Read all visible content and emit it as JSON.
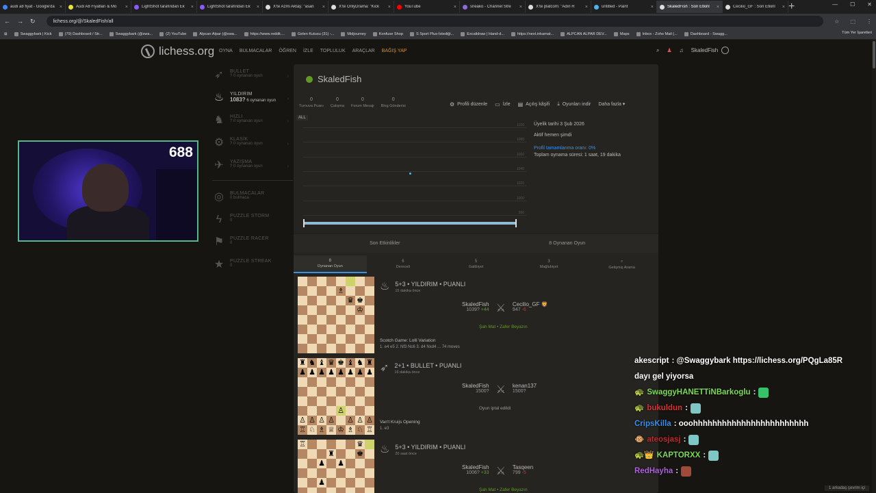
{
  "browser": {
    "tabs": [
      {
        "title": "audi a8 fiyat - Google'da",
        "color": "#4285f4"
      },
      {
        "title": "Audi A8 Fiyatları & Mo",
        "color": "#e8e33a"
      },
      {
        "title": "LightShot tarafından Ek",
        "color": "#8a5cf6"
      },
      {
        "title": "LightShot tarafından Ek",
        "color": "#8a5cf6"
      },
      {
        "title": "X'te Azmi Aktaş: \"asan",
        "color": "#dddddd"
      },
      {
        "title": "X'te OnlyDrama: \"Kick",
        "color": "#dddddd"
      },
      {
        "title": "YouTube",
        "color": "#ff0000"
      },
      {
        "title": "sneako - Channel Stre",
        "color": "#8b6bd9"
      },
      {
        "title": "X'te platcom: \"Adın R",
        "color": "#dddddd"
      },
      {
        "title": "untitled - Paint",
        "color": "#4fb3e8"
      },
      {
        "title": "SkaledFish : Son Etkinl",
        "color": "#dddddd"
      },
      {
        "title": "Cecilio_GF : Son Etkinl",
        "color": "#dddddd"
      }
    ],
    "url": "lichess.org/@/SkaledFish/all",
    "bookmarks": [
      "Swaggybark | Kick",
      "(79) Dashboard / Str...",
      "Swaggybark (@swa...",
      "(2) YouTube",
      "Alpcan Alpar (@swa...",
      "https://www.reddit....",
      "Gelen Kutusu (31) -...",
      "Midjourney",
      "Konfuse Shop",
      "S Sport Plus-İstediği...",
      "Excalidraw | Hand-d...",
      "https://next.inkamat...",
      "ALPCAN ALPAR DEV...",
      "Maps",
      "Inbox - Zoho Mail (...",
      "Dashboard - Swagg..."
    ],
    "all_bookmarks": "Tüm Yer İşaretleri"
  },
  "header": {
    "logo": "lichess.org",
    "nav": [
      "OYNA",
      "BULMACALAR",
      "ÖĞREN",
      "İZLE",
      "TOPLULUK",
      "ARAÇLAR"
    ],
    "donate": "BAĞIŞ YAP",
    "user": "SkaledFish"
  },
  "sidebar": {
    "perfs": [
      {
        "name": "BULLET",
        "val": "? 0 oynanan oyun",
        "icon": "➶",
        "active": false
      },
      {
        "name": "YILDIRIM",
        "rating": "1083?",
        "val": "6 oynanan oyun",
        "icon": "♨",
        "active": true
      },
      {
        "name": "HIZLI",
        "val": "? 0 oynanan oyun",
        "icon": "♞",
        "active": false
      },
      {
        "name": "KLASİK",
        "val": "? 0 oynanan oyun",
        "icon": "⚙",
        "active": false
      },
      {
        "name": "YAZIŞMA",
        "val": "? 0 oynanan oyun",
        "icon": "✈",
        "active": false
      }
    ],
    "puzzles": [
      {
        "name": "BULMACALAR",
        "val": "0 bulmaca",
        "icon": "◎"
      },
      {
        "name": "PUZZLE STORM",
        "val": "0",
        "icon": "ϟ"
      },
      {
        "name": "PUZZLE RACER",
        "val": "0",
        "icon": "⚑"
      },
      {
        "name": "PUZZLE STREAK",
        "val": "0",
        "icon": "★"
      }
    ]
  },
  "webcam": {
    "counter": "688"
  },
  "profile": {
    "username": "SkaledFish",
    "stats": [
      {
        "num": "0",
        "label": "Turnuva Puanı"
      },
      {
        "num": "0",
        "label": "Çalışma"
      },
      {
        "num": "0",
        "label": "Forum Mesajı"
      },
      {
        "num": "0",
        "label": "Blog Gönderisi"
      }
    ],
    "actions": [
      {
        "label": "Profili düzenle",
        "icon": "⚙"
      },
      {
        "label": "İzle",
        "icon": "▭"
      },
      {
        "label": "Açılış kâşifi",
        "icon": "▤"
      },
      {
        "label": "Oyunları indir",
        "icon": "⤓"
      },
      {
        "label": "Daha fazla ▾",
        "icon": ""
      }
    ],
    "chart_btn": "ALL",
    "chart_ticks": [
      "1100",
      "1080",
      "1060",
      "1040",
      "1020",
      "1000",
      "980"
    ],
    "member_since": "Üyelik tarihi 3 Şub 2026",
    "active": "Aktif hemen şimdi",
    "profile_completion": "Profil tamamlanma oranı: 0%",
    "total_time": "Toplam oynama süresi: 1 saat, 19 dakika"
  },
  "section_tabs": [
    "Son Etkinlikler",
    "8 Oynanan Oyun"
  ],
  "game_tabs": [
    {
      "n": "8",
      "label": "Oynanan Oyun"
    },
    {
      "n": "6",
      "label": "Dereceli"
    },
    {
      "n": "5",
      "label": "Galibiyet"
    },
    {
      "n": "3",
      "label": "Mağlubiyet"
    },
    {
      "n": "⌕",
      "label": "Gelişmiş Arama"
    }
  ],
  "games": [
    {
      "mode": "5+3 • YILDIRIM • PUANLI",
      "time": "15 dakika önce",
      "p1": "SkaledFish",
      "r1": "1039?",
      "d1": "+44",
      "p2": "Cecilio_GF 🦁",
      "r2": "947",
      "d2": "-6",
      "result": "Şah Mat • Zafer Beyazın",
      "opening": "Scotch Game: Lolli Variation",
      "moves": "1. e4 e5 2. Nf3 Nc6 3. d4 Nxd4 ... 74 moves",
      "icon": "♨",
      "board": [
        "........",
        "....♗...",
        ".....♛♚.",
        "......♔.",
        "........",
        "........",
        "........",
        "........"
      ],
      "hl": [
        [
          0,
          5
        ]
      ]
    },
    {
      "mode": "2+1 • BULLET • PUANLI",
      "time": "16 dakika önce",
      "p1": "SkaledFish",
      "r1": "1500?",
      "d1": "",
      "p2": "kenan137",
      "r2": "1500?",
      "d2": "",
      "result": "Oyun iptal edildi",
      "opening": "Van't Kruijs Opening",
      "moves": "1. e3",
      "icon": "➶",
      "board": [
        "♜♞♝♛♚♝♞♜",
        "♟♟♟♟♟♟♟♟",
        "........",
        "........",
        "........",
        "....♙...",
        "♙♙♙♙.♙♙♙",
        "♖♘♗♕♔♗♘♖"
      ],
      "hl": [
        [
          5,
          4
        ]
      ]
    },
    {
      "mode": "5+3 • YILDIRIM • PUANLI",
      "time": "20 saat önce",
      "p1": "SkaledFish",
      "r1": "1006?",
      "d1": "+33",
      "p2": "Tasqeen",
      "r2": "799",
      "d2": "-5",
      "result": "Şah Mat • Zafer Beyazın",
      "opening": "",
      "moves": "",
      "icon": "♨",
      "board": [
        "♖.....♛.",
        "...♜..♚.",
        "..♟.♟...",
        "........",
        "..♟.....",
        "........",
        "........",
        "........"
      ],
      "hl": [
        [
          0,
          7
        ]
      ]
    }
  ],
  "chat": [
    {
      "user": "akescript",
      "color": "#ffffff",
      "badge": "",
      "text": ": @Swaggybark https://lichess.org/PQgLa85R"
    },
    {
      "user": "",
      "color": "#ffffff",
      "badge": "",
      "text": "dayı gel yiyorsa"
    },
    {
      "user": "SwaggyHANETTiNBarkoglu",
      "color": "#7ed957",
      "badge": "🐢",
      "text": " :",
      "emote": "#35c26a"
    },
    {
      "user": "bukuldun",
      "color": "#e03030",
      "badge": "🐢",
      "text": " :",
      "emote": "#7fc7c4"
    },
    {
      "user": "CripsKilla",
      "color": "#3a8ee6",
      "badge": "",
      "text": ": ooohhhhhhhhhhhhhhhhhhhhhhhh"
    },
    {
      "user": "ateosjasj",
      "color": "#c02a2a",
      "badge": "🐵",
      "text": " :",
      "emote": "#7fc7c4"
    },
    {
      "user": "KAPTORXX",
      "color": "#7ed957",
      "badge": "🐢👑",
      "text": " :",
      "emote": "#7fc7c4"
    },
    {
      "user": "RedHayha",
      "color": "#b060e0",
      "badge": "",
      "text": " :",
      "emote": "#a04a3a"
    }
  ],
  "friends_bar": "1 arkadaş çevrim içi"
}
